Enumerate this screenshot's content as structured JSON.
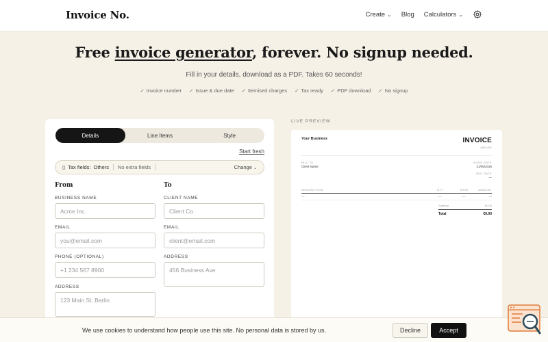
{
  "header": {
    "logo": "Invoice No.",
    "nav": [
      {
        "label": "Create",
        "has_caret": true
      },
      {
        "label": "Blog",
        "has_caret": false
      },
      {
        "label": "Calculators",
        "has_caret": true
      }
    ],
    "settings_icon": "gear-icon"
  },
  "hero": {
    "title_pre": "Free ",
    "title_link": "invoice generator",
    "title_post": ", forever. No signup needed.",
    "subtitle": "Fill in your details, download as a PDF. Takes 60 seconds!",
    "features": [
      "Invoice number",
      "Issue & due date",
      "Itemised charges",
      "Tax ready",
      "PDF download",
      "No signup"
    ]
  },
  "form": {
    "tabs": [
      {
        "label": "Details",
        "active": true
      },
      {
        "label": "Line Items",
        "active": false
      },
      {
        "label": "Style",
        "active": false
      }
    ],
    "start_fresh": "Start fresh",
    "tax_bar": {
      "label": "Tax fields:",
      "value": "Others",
      "note": "No extra fields",
      "change": "Change"
    },
    "from": {
      "heading": "From",
      "business_name_label": "BUSINESS NAME",
      "business_name_placeholder": "Acme Inc.",
      "email_label": "EMAIL",
      "email_placeholder": "you@email.com",
      "phone_label": "PHONE (OPTIONAL)",
      "phone_placeholder": "+1 234 567 8900",
      "address_label": "ADDRESS",
      "address_placeholder": "123 Main St, Berlin"
    },
    "to": {
      "heading": "To",
      "client_name_label": "CLIENT NAME",
      "client_name_placeholder": "Client Co.",
      "email_label": "EMAIL",
      "email_placeholder": "client@email.com",
      "address_label": "ADDRESS",
      "address_placeholder": "456 Business Ave"
    }
  },
  "preview": {
    "label": "LIVE PREVIEW",
    "business": "Your Business",
    "title": "INVOICE",
    "invoice_no": "#INV-001",
    "bill_to_label": "BILL TO",
    "client": "Client Name",
    "issue_date_label": "ISSUE DATE",
    "issue_date": "21/05/2026",
    "due_date_label": "DUE DATE",
    "due_date": "—",
    "col_description": "DESCRIPTION",
    "col_qty": "QTY",
    "col_rate": "RATE",
    "col_amount": "AMOUNT",
    "row_dash": "—",
    "subtotal_label": "Subtotal",
    "subtotal": "€0.00",
    "total_label": "Total",
    "total": "€0.00"
  },
  "cookie": {
    "text": "We use cookies to understand how people use this site. No personal data is stored by us.",
    "decline": "Decline",
    "accept": "Accept"
  },
  "help_widget_icon": "help-search-icon"
}
